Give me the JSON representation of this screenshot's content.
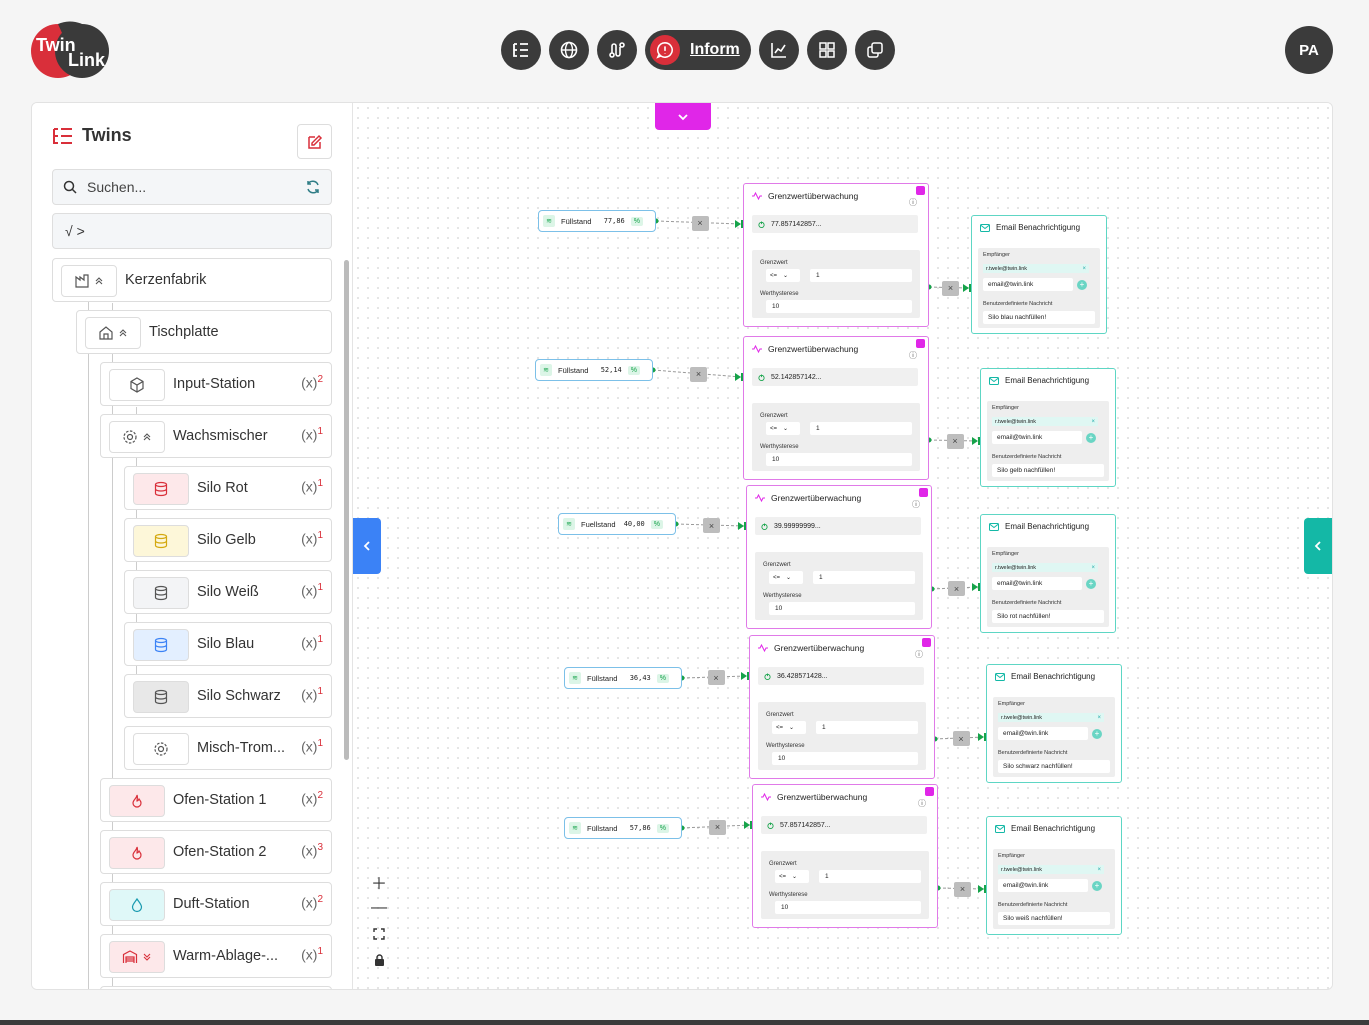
{
  "header": {
    "logo_text_1": "Twin",
    "logo_text_2": "Link",
    "toolbar": [
      {
        "icon": "list-tree-icon"
      },
      {
        "icon": "globe-icon"
      },
      {
        "icon": "route-icon"
      },
      {
        "icon": "alert-icon",
        "label": "Inform"
      },
      {
        "icon": "chart-icon"
      },
      {
        "icon": "dashboard-icon"
      },
      {
        "icon": "copy-icon"
      }
    ],
    "avatar": "PA"
  },
  "sidebar": {
    "title": "Twins",
    "search_placeholder": "Suchen...",
    "filter_label": "√ >",
    "items": [
      {
        "name": "Kerzenfabrik",
        "icon": "factory-icon"
      },
      {
        "name": "Tischplatte",
        "icon": "home-icon"
      },
      {
        "name": "Input-Station",
        "icon": "box-icon",
        "count": "2"
      },
      {
        "name": "Wachsmischer",
        "icon": "gear-icon",
        "count": "1"
      },
      {
        "name": "Silo Rot",
        "icon": "database-icon",
        "count": "1",
        "color": "#fde8ea"
      },
      {
        "name": "Silo Gelb",
        "icon": "database-icon",
        "count": "1",
        "color": "#fdf7d9"
      },
      {
        "name": "Silo Weiß",
        "icon": "database-icon",
        "count": "1",
        "color": "#f3f4f6"
      },
      {
        "name": "Silo Blau",
        "icon": "database-icon",
        "count": "1",
        "color": "#e3efff"
      },
      {
        "name": "Silo Schwarz",
        "icon": "database-icon",
        "count": "1",
        "color": "#e8e8e8"
      },
      {
        "name": "Misch-Trom...",
        "icon": "gear-icon",
        "count": "1"
      },
      {
        "name": "Ofen-Station 1",
        "icon": "flame-icon",
        "count": "2",
        "color": "#fde8ea"
      },
      {
        "name": "Ofen-Station 2",
        "icon": "flame-icon",
        "count": "3",
        "color": "#fde8ea"
      },
      {
        "name": "Duft-Station",
        "icon": "droplet-icon",
        "count": "2",
        "color": "#dff8f8"
      },
      {
        "name": "Warm-Ablage-...",
        "icon": "warehouse-icon",
        "count": "1",
        "color": "#fde8ea"
      }
    ]
  },
  "flows": [
    {
      "sensor_label": "Füllstand",
      "sensor_value": "77,86",
      "unit": "%",
      "monitor_title": "Grenzwertüberwachung",
      "monitor_value": "77.857142857...",
      "grenzwert_label": "Grenzwert",
      "op": "<=",
      "grenzwert": "1",
      "hyst_label": "Werthysterese",
      "hyst": "10",
      "email_title": "Email Benachrichtigung",
      "recipient_label": "Empfänger",
      "recipient": "r.twele@twin.link",
      "email_placeholder": "email@twin.link",
      "msg_label": "Benutzerdefinierte Nachricht",
      "message": "Silo blau nachfüllen!"
    },
    {
      "sensor_label": "Füllstand",
      "sensor_value": "52,14",
      "unit": "%",
      "monitor_title": "Grenzwertüberwachung",
      "monitor_value": "52.142857142...",
      "grenzwert_label": "Grenzwert",
      "op": "<=",
      "grenzwert": "1",
      "hyst_label": "Werthysterese",
      "hyst": "10",
      "email_title": "Email Benachrichtigung",
      "recipient_label": "Empfänger",
      "recipient": "r.twele@twin.link",
      "email_placeholder": "email@twin.link",
      "msg_label": "Benutzerdefinierte Nachricht",
      "message": "Silo gelb nachfüllen!"
    },
    {
      "sensor_label": "Fuellstand",
      "sensor_value": "40,00",
      "unit": "%",
      "monitor_title": "Grenzwertüberwachung",
      "monitor_value": "39.99999999...",
      "grenzwert_label": "Grenzwert",
      "op": "<=",
      "grenzwert": "1",
      "hyst_label": "Werthysterese",
      "hyst": "10",
      "email_title": "Email Benachrichtigung",
      "recipient_label": "Empfänger",
      "recipient": "r.twele@twin.link",
      "email_placeholder": "email@twin.link",
      "msg_label": "Benutzerdefinierte Nachricht",
      "message": "Silo rot nachfüllen!"
    },
    {
      "sensor_label": "Füllstand",
      "sensor_value": "36,43",
      "unit": "%",
      "monitor_title": "Grenzwertüberwachung",
      "monitor_value": "36.428571428...",
      "grenzwert_label": "Grenzwert",
      "op": "<=",
      "grenzwert": "1",
      "hyst_label": "Werthysterese",
      "hyst": "10",
      "email_title": "Email Benachrichtigung",
      "recipient_label": "Empfänger",
      "recipient": "r.twele@twin.link",
      "email_placeholder": "email@twin.link",
      "msg_label": "Benutzerdefinierte Nachricht",
      "message": "Silo schwarz nachfüllen!"
    },
    {
      "sensor_label": "Füllstand",
      "sensor_value": "57,86",
      "unit": "%",
      "monitor_title": "Grenzwertüberwachung",
      "monitor_value": "57.857142857...",
      "grenzwert_label": "Grenzwert",
      "op": "<=",
      "grenzwert": "1",
      "hyst_label": "Werthysterese",
      "hyst": "10",
      "email_title": "Email Benachrichtigung",
      "recipient_label": "Empfänger",
      "recipient": "r.twele@twin.link",
      "email_placeholder": "email@twin.link",
      "msg_label": "Benutzerdefinierte Nachricht",
      "message": "Silo weiß nachfüllen!"
    }
  ],
  "colors": {
    "accent": "#d92f3a",
    "monitor": "#e026e8",
    "email": "#14b8a6",
    "left_toggle": "#3b82f6"
  }
}
